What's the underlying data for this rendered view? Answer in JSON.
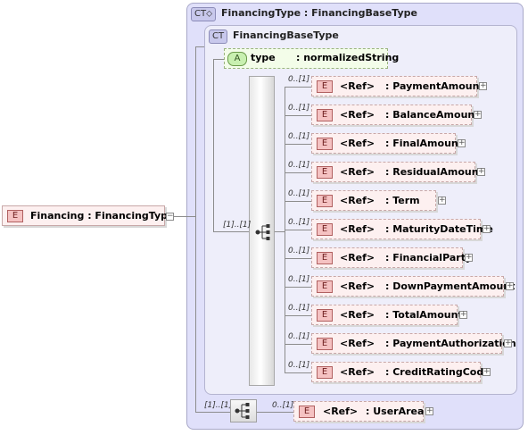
{
  "root_element": {
    "badge": "E",
    "label": "Financing : FinancingType"
  },
  "outer_type": {
    "badge": "CT",
    "title": "FinancingType : FinancingBaseType"
  },
  "inner_type": {
    "badge": "CT",
    "title": "FinancingBaseType"
  },
  "attribute": {
    "badge": "A",
    "name": "type",
    "type": ": normalizedString"
  },
  "sequence_cardinality": "[1]..[1]",
  "elements": [
    {
      "badge": "E",
      "ref": "<Ref>",
      "name": ": PaymentAmount",
      "card": "0..[1]"
    },
    {
      "badge": "E",
      "ref": "<Ref>",
      "name": ": BalanceAmount",
      "card": "0..[1]"
    },
    {
      "badge": "E",
      "ref": "<Ref>",
      "name": ": FinalAmount",
      "card": "0..[1]"
    },
    {
      "badge": "E",
      "ref": "<Ref>",
      "name": ": ResidualAmount",
      "card": "0..[1]"
    },
    {
      "badge": "E",
      "ref": "<Ref>",
      "name": ": Term",
      "card": "0..[1]"
    },
    {
      "badge": "E",
      "ref": "<Ref>",
      "name": ": MaturityDateTime",
      "card": "0..[1]"
    },
    {
      "badge": "E",
      "ref": "<Ref>",
      "name": ": FinancialParty",
      "card": "0..[1]"
    },
    {
      "badge": "E",
      "ref": "<Ref>",
      "name": ": DownPaymentAmount",
      "card": "0..[1]"
    },
    {
      "badge": "E",
      "ref": "<Ref>",
      "name": ": TotalAmount",
      "card": "0..[1]"
    },
    {
      "badge": "E",
      "ref": "<Ref>",
      "name": ": PaymentAuthorization",
      "card": "0..[1]"
    },
    {
      "badge": "E",
      "ref": "<Ref>",
      "name": ": CreditRatingCode",
      "card": "0..[1]"
    }
  ],
  "outer_sequence_cardinality": "[1]..[1]",
  "user_area": {
    "badge": "E",
    "ref": "<Ref>",
    "name": ": UserArea",
    "card": "0..[1]"
  },
  "expand_glyph": "+",
  "collapse_glyph": "−",
  "colors": {
    "element_fill": "#fdf0f0",
    "element_badge": "#f5c2c2",
    "attribute_fill": "#f3fde9",
    "complex_type_fill": "#e0e0fa"
  }
}
